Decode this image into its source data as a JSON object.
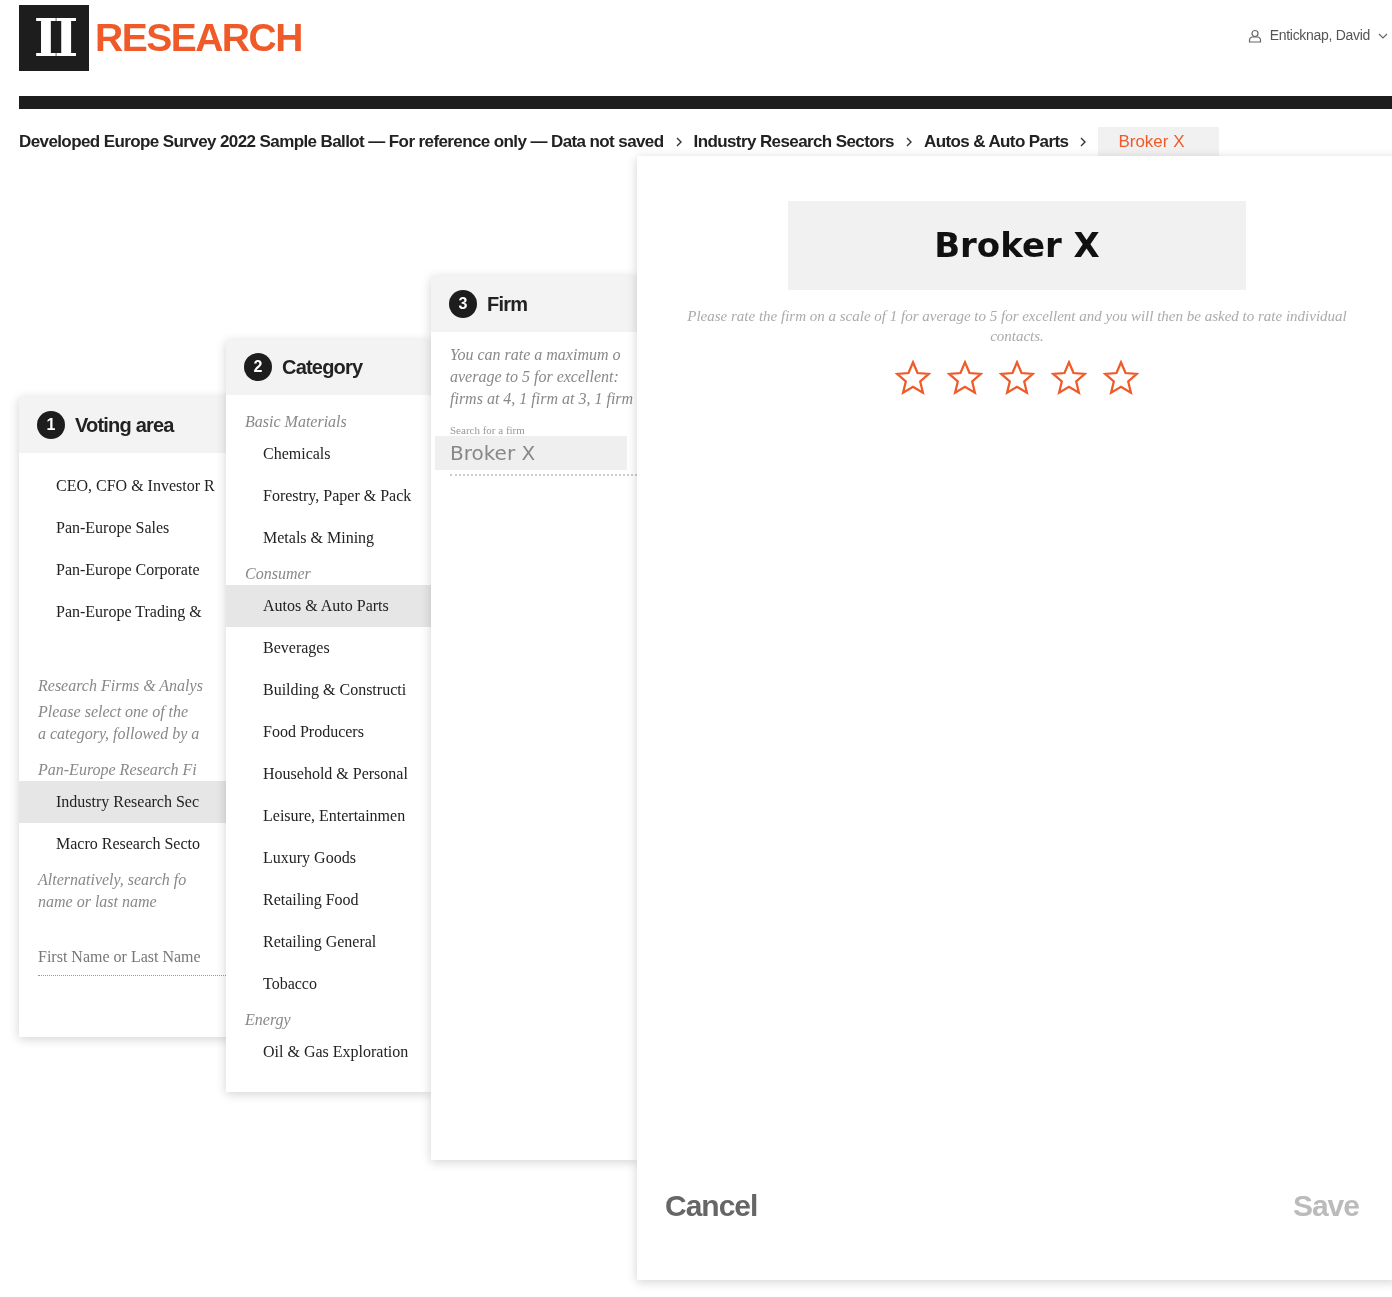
{
  "header": {
    "logo_mark": "II",
    "logo_text": "RESEARCH",
    "user": {
      "name": "Enticknap, David"
    }
  },
  "breadcrumb": [
    {
      "label": "Developed Europe Survey 2022 Sample Ballot — For reference only — Data not saved",
      "selected": false
    },
    {
      "label": "Industry Research Sectors",
      "selected": false
    },
    {
      "label": "Autos & Auto Parts",
      "selected": false
    },
    {
      "label": "Broker X",
      "selected": true
    }
  ],
  "voting_panel": {
    "number": "1",
    "title": "Voting area",
    "rows": [
      {
        "kind": "item",
        "label": "CEO, CFO & Investor R",
        "selected": false
      },
      {
        "kind": "item",
        "label": "Pan-Europe Sales",
        "selected": false
      },
      {
        "kind": "item",
        "label": "Pan-Europe Corporate",
        "selected": false
      },
      {
        "kind": "item",
        "label": "Pan-Europe Trading &",
        "selected": false
      },
      {
        "kind": "spacer"
      },
      {
        "kind": "heading",
        "label": "Research Firms & Analys"
      },
      {
        "kind": "note",
        "lines": [
          "Please select one of the",
          "a category, followed by a"
        ]
      },
      {
        "kind": "heading",
        "label": "Pan-Europe Research Fi"
      },
      {
        "kind": "item",
        "label": "Industry Research Sec",
        "selected": true
      },
      {
        "kind": "item",
        "label": "Macro Research Secto",
        "selected": false
      },
      {
        "kind": "note",
        "lines": [
          "Alternatively,  search  fo",
          "name or last name"
        ]
      },
      {
        "kind": "field",
        "placeholder": "First Name or Last Name"
      }
    ]
  },
  "category_panel": {
    "number": "2",
    "title": "Category",
    "rows": [
      {
        "kind": "heading",
        "label": "Basic Materials"
      },
      {
        "kind": "item",
        "label": "Chemicals",
        "selected": false
      },
      {
        "kind": "item",
        "label": "Forestry, Paper & Pack",
        "selected": false
      },
      {
        "kind": "item",
        "label": "Metals & Mining",
        "selected": false
      },
      {
        "kind": "heading",
        "label": "Consumer"
      },
      {
        "kind": "item",
        "label": "Autos & Auto Parts",
        "selected": true
      },
      {
        "kind": "item",
        "label": "Beverages",
        "selected": false
      },
      {
        "kind": "item",
        "label": "Building & Constructi",
        "selected": false
      },
      {
        "kind": "item",
        "label": "Food Producers",
        "selected": false
      },
      {
        "kind": "item",
        "label": "Household & Personal",
        "selected": false
      },
      {
        "kind": "item",
        "label": "Leisure, Entertainmen",
        "selected": false
      },
      {
        "kind": "item",
        "label": "Luxury Goods",
        "selected": false
      },
      {
        "kind": "item",
        "label": "Retailing Food",
        "selected": false
      },
      {
        "kind": "item",
        "label": "Retailing General",
        "selected": false
      },
      {
        "kind": "item",
        "label": "Tobacco",
        "selected": false
      },
      {
        "kind": "heading",
        "label": "Energy"
      },
      {
        "kind": "item",
        "label": "Oil & Gas Exploration",
        "selected": false
      }
    ]
  },
  "firm_panel": {
    "number": "3",
    "title": "Firm",
    "rows": [
      {
        "kind": "note",
        "lines": [
          "You can rate a maximum o",
          "average to 5 for excellent:",
          "firms at 4, 1 firm at 3, 1 firm"
        ]
      },
      {
        "kind": "search",
        "label": "Search for a firm",
        "value": "Broker X"
      }
    ]
  },
  "rating_dialog": {
    "title": "Broker X",
    "instructions": "Please rate the firm on a scale of 1 for average to 5 for excellent and you will then be asked to rate individual contacts.",
    "stars": 0,
    "buttons": [
      {
        "label": "Cancel",
        "disabled": false
      },
      {
        "label": "Save",
        "disabled": true
      }
    ]
  }
}
